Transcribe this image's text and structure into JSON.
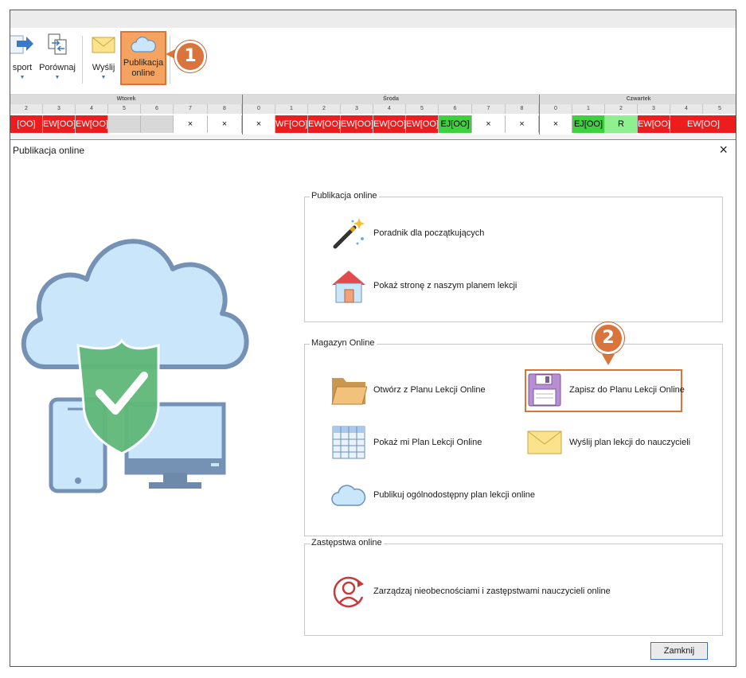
{
  "ribbon": {
    "buttons": [
      {
        "label": "sport"
      },
      {
        "label": "Porównaj"
      },
      {
        "label": "Wyślij"
      },
      {
        "label1": "Publikacja",
        "label2": "online"
      }
    ],
    "callout1": "1"
  },
  "grid": {
    "days": [
      "Wtorek",
      "Środa",
      "Czwartek"
    ],
    "cells": [
      "[OO]",
      "EW[OO]",
      "EW[OO]",
      "",
      "",
      "×",
      "×",
      "×",
      "WF[OO]",
      "EW[OO]",
      "EW[OO]",
      "EW[OO]",
      "EW[OO]",
      "EJ[OO]",
      "×",
      "×",
      "×",
      "EJ[OO]",
      "R",
      "EW[OO]",
      "EW[OO]"
    ],
    "numbers_tue": [
      "2",
      "3",
      "4",
      "5",
      "6",
      "7",
      "8"
    ],
    "numbers_wed": [
      "0",
      "1",
      "2",
      "3",
      "4",
      "5",
      "6",
      "7",
      "8"
    ],
    "numbers_thu": [
      "0",
      "1",
      "2",
      "3",
      "4",
      "5"
    ]
  },
  "dialog": {
    "title": "Publikacja online",
    "close_symbol": "×",
    "group1": {
      "title": "Publikacja online",
      "items": [
        "Poradnik dla początkujących",
        "Pokaż stronę z naszym planem lekcji"
      ]
    },
    "group2": {
      "title": "Magazyn Online",
      "items": [
        "Otwórz z Planu Lekcji Online",
        "Zapisz do Planu Lekcji Online",
        "Pokaż mi Plan Lekcji Online",
        "Wyślij plan lekcji do nauczycieli",
        "Publikuj ogólnodostępny plan lekcji online"
      ]
    },
    "group3": {
      "title": "Zastępstwa online",
      "items": [
        "Zarządzaj nieobecnościami i zastępstwami nauczycieli online"
      ]
    },
    "callout2": "2",
    "close_button": "Zamknij"
  },
  "colors": {
    "accent": "#d9743d",
    "cell_red": "#ee1c1c",
    "cell_green": "#3dd13d",
    "cloud": "#c9e6fb",
    "shield": "#5fb878"
  }
}
